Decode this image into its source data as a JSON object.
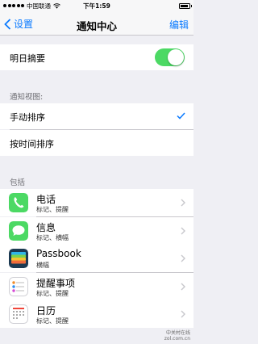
{
  "status": {
    "carrier": "中国联通",
    "time": "下午1:59",
    "battery_level": 0.85
  },
  "nav": {
    "back_label": "设置",
    "title": "通知中心",
    "edit_label": "编辑"
  },
  "summary": {
    "label": "明日摘要",
    "toggle_on": true
  },
  "view_section": {
    "header": "通知视图:",
    "options": [
      {
        "label": "手动排序",
        "selected": true
      },
      {
        "label": "按时间排序",
        "selected": false
      }
    ]
  },
  "include_section": {
    "header": "包括",
    "apps": [
      {
        "name": "电话",
        "detail": "标记、提醒",
        "icon": "phone-icon"
      },
      {
        "name": "信息",
        "detail": "标记、横幅",
        "icon": "messages-icon"
      },
      {
        "name": "Passbook",
        "detail": "横幅",
        "icon": "passbook-icon"
      },
      {
        "name": "提醒事项",
        "detail": "标记、提醒",
        "icon": "reminders-icon"
      },
      {
        "name": "日历",
        "detail": "标记、提醒",
        "icon": "calendar-icon"
      }
    ]
  },
  "colors": {
    "accent": "#0a7aff",
    "toggle_on": "#4cd964",
    "background": "#efeff4"
  },
  "watermark": {
    "line1": "中关村在线",
    "line2": "zol.com.cn"
  }
}
